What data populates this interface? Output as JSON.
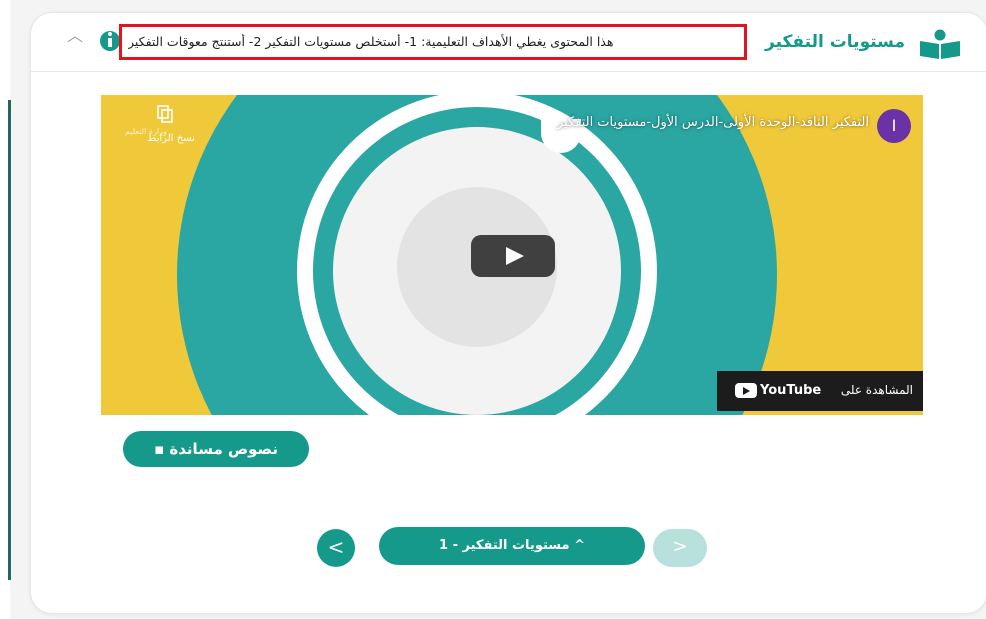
{
  "header": {
    "title": "مستويات التفكير",
    "description": "هذا المحتوى يغطي الأهداف التعليمية: 1- أستخلص مستويات التفكير 2- أستنتج معوقات التفكير",
    "collapse_glyph": "︿"
  },
  "video": {
    "channel_initial": "I",
    "title": "التفكير الناقد-الوحدة الأولى-الدرس الأول-مستويات التفكير",
    "copy_link_label": "نسخ الرابط",
    "watch_on_label": "المشاهدة على",
    "youtube_label": "YouTube",
    "overlay_logo_text": "وزارة التعليم"
  },
  "actions": {
    "support_texts_label": "نصوص مساندة"
  },
  "pagination": {
    "prev_glyph": "<",
    "current_label": "مستويات التفكير - 1 ^",
    "next_glyph": ">"
  },
  "colors": {
    "brand_teal": "#14998a",
    "highlight_red": "#e4141e",
    "video_yellow": "#f0c93a",
    "video_teal": "#2aa6a3"
  }
}
